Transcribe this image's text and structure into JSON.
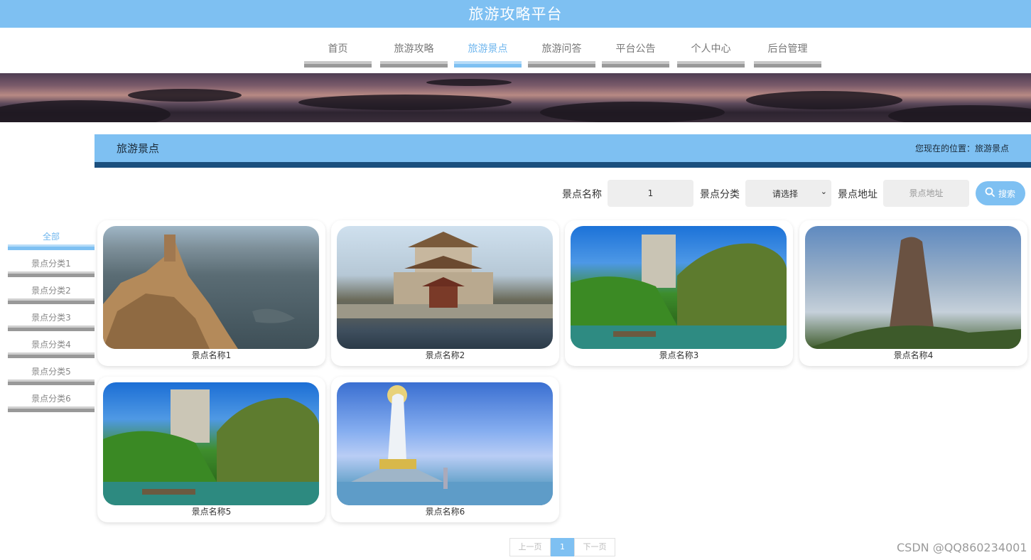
{
  "header": {
    "title": "旅游攻略平台"
  },
  "nav": {
    "items": [
      {
        "label": "首页"
      },
      {
        "label": "旅游攻略"
      },
      {
        "label": "旅游景点"
      },
      {
        "label": "旅游问答"
      },
      {
        "label": "平台公告"
      },
      {
        "label": "个人中心"
      },
      {
        "label": "后台管理"
      }
    ],
    "active": "旅游景点"
  },
  "breadcrumb": {
    "heading": "旅游景点",
    "location": "您现在的位置：旅游景点"
  },
  "search": {
    "name_label": "景点名称",
    "name_value": "1",
    "category_label": "景点分类",
    "category_selected": "请选择",
    "address_label": "景点地址",
    "address_placeholder": "景点地址",
    "button_label": "搜索"
  },
  "sidebar": {
    "items": [
      {
        "label": "全部"
      },
      {
        "label": "景点分类1"
      },
      {
        "label": "景点分类2"
      },
      {
        "label": "景点分类3"
      },
      {
        "label": "景点分类4"
      },
      {
        "label": "景点分类5"
      },
      {
        "label": "景点分类6"
      }
    ],
    "active": "全部"
  },
  "spots": [
    {
      "name": "景点名称1"
    },
    {
      "name": "景点名称2"
    },
    {
      "name": "景点名称3"
    },
    {
      "name": "景点名称4"
    },
    {
      "name": "景点名称5"
    },
    {
      "name": "景点名称6"
    }
  ],
  "pagination": {
    "prev_label": "上一页",
    "current_page": "1",
    "next_label": "下一页"
  },
  "watermark": "CSDN @QQ860234001",
  "colors": {
    "accent": "#7ec0f2",
    "accent_dark": "#1a4f7e",
    "nav_bar_inactive": "#999999"
  }
}
